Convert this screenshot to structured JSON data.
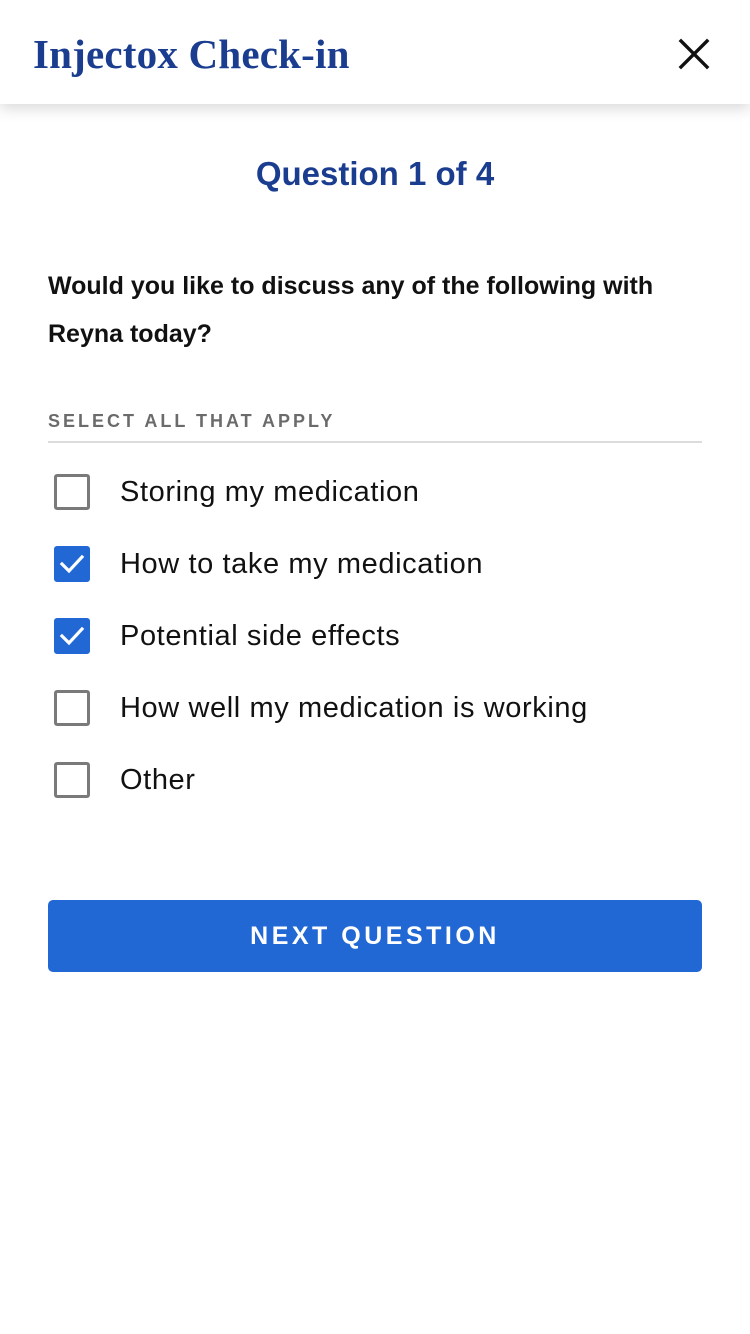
{
  "header": {
    "title": "Injectox Check-in",
    "close_icon": "close-icon"
  },
  "question": {
    "counter": "Question 1 of 4",
    "text": "Would you like to discuss any of the following with Reyna today?",
    "instruction": "SELECT ALL THAT APPLY"
  },
  "options": [
    {
      "label": "Storing my medication",
      "checked": false
    },
    {
      "label": "How to take my medication",
      "checked": true
    },
    {
      "label": "Potential side effects",
      "checked": true
    },
    {
      "label": "How well my medication is working",
      "checked": false
    },
    {
      "label": "Other",
      "checked": false
    }
  ],
  "actions": {
    "next_label": "NEXT QUESTION"
  },
  "colors": {
    "brand_navy": "#1b3d8f",
    "accent_blue": "#2268d4",
    "checkbox_border": "#7a7a7a",
    "instruction_gray": "#6b6b6b"
  }
}
